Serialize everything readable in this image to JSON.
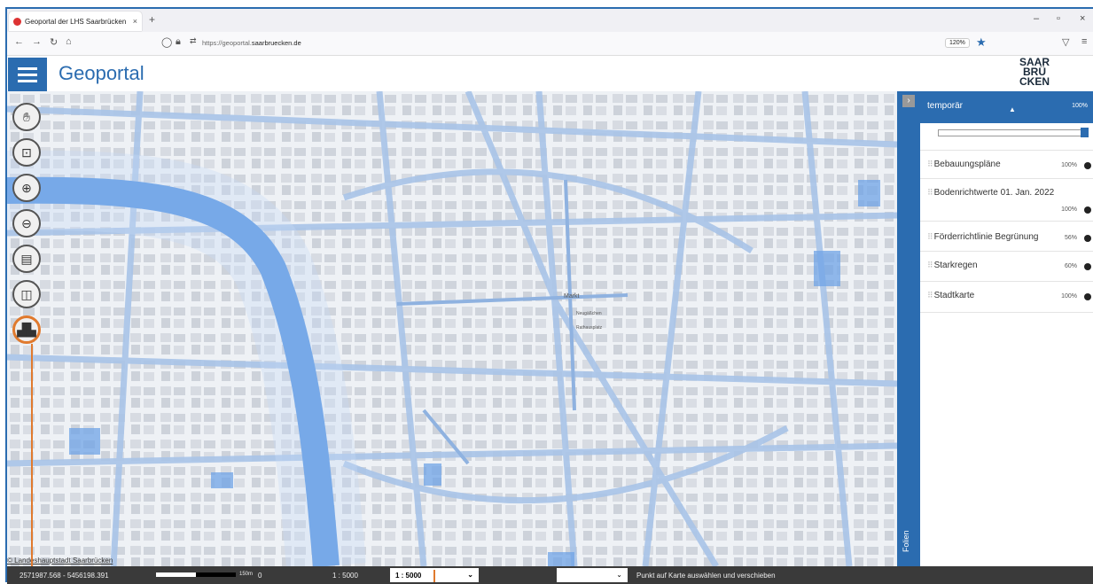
{
  "browser": {
    "tab_title": "Geoportal der LHS Saarbrücken",
    "tab_close": "×",
    "new_tab": "+",
    "url_prefix": "https://geoportal.",
    "url_domain": "saarbruecken.de",
    "zoom": "120%"
  },
  "app": {
    "title": "Geoportal",
    "logo_lines": [
      "SAAR",
      "BRÜ",
      "CKEN"
    ]
  },
  "map": {
    "labels": [
      "Markt",
      "Neugäßchen",
      "Rathausplatz"
    ],
    "copyright": "© Landeshauptstadt Saarbrücken"
  },
  "sidebar": {
    "toggle_label": "Folien",
    "group": {
      "title": "temporär",
      "opacity": "100%"
    },
    "layers": [
      {
        "name": "Bebauungspläne",
        "opacity": "100%"
      },
      {
        "name": "Bodenrichtwerte 01. Jan. 2022",
        "opacity": "100%"
      },
      {
        "name": "Förderrichtlinie Begrünung",
        "opacity": "56%"
      },
      {
        "name": "Starkregen",
        "opacity": "60%"
      },
      {
        "name": "Stadtkarte",
        "opacity": "100%"
      }
    ]
  },
  "status": {
    "coords": "2571987.568 - 5456198.391",
    "scale_unit": "150m",
    "scale_zero": "0",
    "scale_text": "1 : 5000",
    "scale_select": "1 : 5000",
    "hint": "Punkt auf Karte auswählen und verschieben"
  }
}
